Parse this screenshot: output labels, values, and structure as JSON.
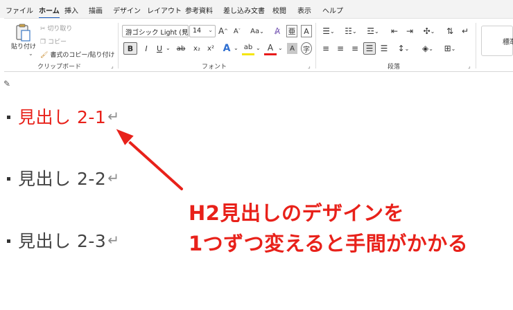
{
  "menu": {
    "tabs": [
      {
        "label": "ファイル"
      },
      {
        "label": "ホーム"
      },
      {
        "label": "挿入"
      },
      {
        "label": "描画"
      },
      {
        "label": "デザイン"
      },
      {
        "label": "レイアウト"
      },
      {
        "label": "参考資料"
      },
      {
        "label": "差し込み文書"
      },
      {
        "label": "校閲"
      },
      {
        "label": "表示"
      },
      {
        "label": "ヘルプ"
      }
    ],
    "active_tab": "ホーム"
  },
  "ribbon": {
    "clipboard": {
      "group_label": "クリップボード",
      "paste_label": "貼り付け",
      "cut_label": "切り取り",
      "copy_label": "コピー",
      "format_painter_label": "書式のコピー/貼り付け"
    },
    "font": {
      "group_label": "フォント",
      "font_name": "游ゴシック Light (見出",
      "font_size": "14",
      "grow_label": "A",
      "shrink_label": "A",
      "case_label": "Aa",
      "bold_label": "B",
      "italic_label": "I",
      "underline_label": "U",
      "strike_label": "ab",
      "subscript_label": "x₂",
      "superscript_label": "x²",
      "text_effect_label": "A",
      "highlight_label": "ab",
      "font_color_label": "A",
      "char_shading_label": "A",
      "enclosed_label": "字"
    },
    "paragraph": {
      "group_label": "段落"
    },
    "styles": {
      "label": "標準"
    }
  },
  "document": {
    "headings": [
      {
        "text": "見出し 2-1",
        "color": "#e8211a"
      },
      {
        "text": "見出し 2-2",
        "color": "#444444"
      },
      {
        "text": "見出し 2-3",
        "color": "#444444"
      }
    ],
    "paragraph_mark": "↵",
    "annotation": {
      "line1": "H2見出しのデザインを",
      "line2": "1つずつ変えると手間がかかる",
      "color": "#e8211a"
    }
  }
}
